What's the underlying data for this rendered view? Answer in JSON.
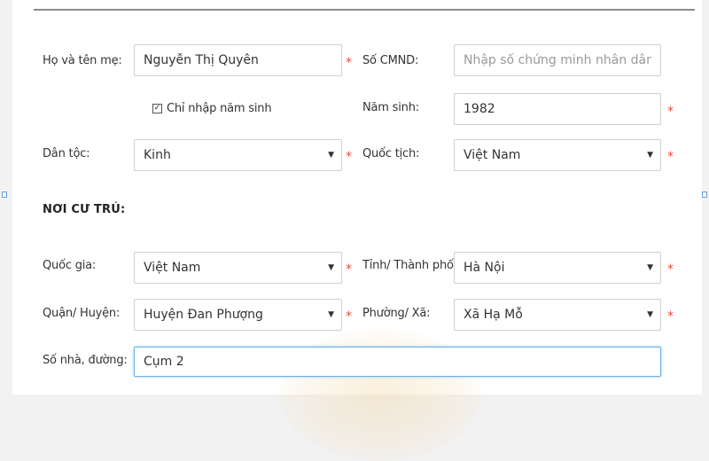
{
  "mother": {
    "name_label": "Họ và tên mẹ:",
    "name_value": "Nguyễn Thị Quyên",
    "id_label": "Số CMND:",
    "id_placeholder": "Nhập số chứng minh nhân dân",
    "birthyear_only_label": "Chỉ nhập năm sinh",
    "birthyear_only_checked": true,
    "birthyear_label": "Năm sinh:",
    "birthyear_value": "1982",
    "ethnicity_label": "Dân tộc:",
    "ethnicity_value": "Kinh",
    "nationality_label": "Quốc tịch:",
    "nationality_value": "Việt Nam"
  },
  "residence": {
    "section_title": "NƠI CƯ TRÚ:",
    "country_label": "Quốc gia:",
    "country_value": "Việt Nam",
    "province_label": "Tỉnh/ Thành phố:",
    "province_value": "Hà Nội",
    "district_label": "Quận/ Huyện:",
    "district_value": "Huyện Đan Phượng",
    "ward_label": "Phường/ Xã:",
    "ward_value": "Xã Hạ Mỗ",
    "address_label": "Số nhà, đường:",
    "address_value": "Cụm 2"
  },
  "required_mark": "*",
  "checkbox_mark": "✓",
  "caret_icon": "▼",
  "colors": {
    "required": "#e74c3c",
    "focus_border": "#66afe9",
    "input_border": "#cfcfcf"
  }
}
